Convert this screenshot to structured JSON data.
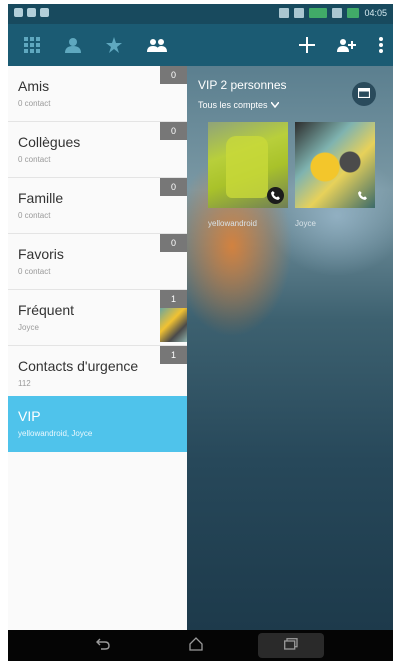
{
  "status_bar": {
    "time": "04:05"
  },
  "toolbar": {
    "icons": [
      "dialpad-icon",
      "contact-icon",
      "star-icon",
      "groups-icon",
      "add-icon",
      "manage-groups-icon",
      "overflow-menu-icon"
    ]
  },
  "groups": [
    {
      "name": "Amis",
      "subtitle": "0 contact",
      "count": "0"
    },
    {
      "name": "Collègues",
      "subtitle": "0 contact",
      "count": "0"
    },
    {
      "name": "Famille",
      "subtitle": "0 contact",
      "count": "0"
    },
    {
      "name": "Favoris",
      "subtitle": "0 contact",
      "count": "0"
    },
    {
      "name": "Fréquent",
      "subtitle": "Joyce",
      "count": "1"
    },
    {
      "name": "Contacts d'urgence",
      "subtitle": "112",
      "count": "1"
    },
    {
      "name": "VIP",
      "subtitle": "yellowandroid, Joyce",
      "count": "",
      "selected": true
    }
  ],
  "vip_panel": {
    "title": "VIP 2 personnes",
    "accounts_filter": "Tous les comptes",
    "contacts": [
      {
        "name": "yellowandroid"
      },
      {
        "name": "Joyce"
      }
    ]
  },
  "colors": {
    "toolbar": "#1b5b73",
    "selected_group": "#4fc3eb",
    "count_badge": "#777777"
  }
}
